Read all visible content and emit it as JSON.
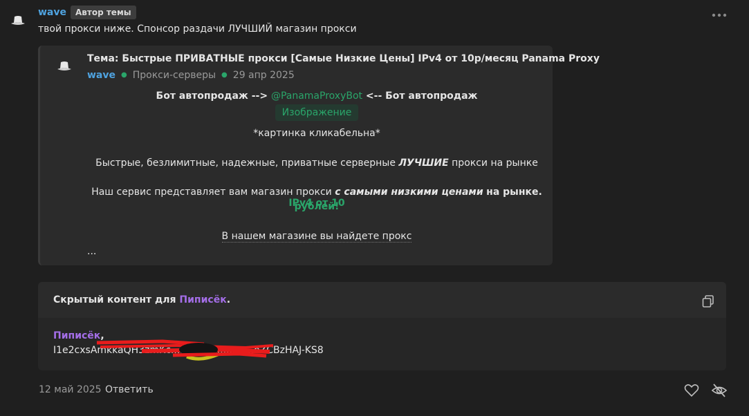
{
  "post": {
    "username": "wave",
    "badge": "Автор темы",
    "message": "твой прокси ниже. Спонсор раздачи ЛУЧШИЙ магазин прокси"
  },
  "quote": {
    "title": "Тема: Быстрые ПРИВАТНЫЕ прокси [Самые Низкие Цены] IPv4 от 10р/месяц Panama Proxy",
    "author": "wave",
    "forum": "Прокси-серверы",
    "date": "29 апр 2025",
    "bot_prefix": "Бот автопродаж -->",
    "bot_link": "@PanamaProxyBot",
    "bot_suffix": "<-- Бот автопродаж",
    "image_label": "Изображение",
    "clickable_note": "*картинка кликабельна*",
    "line1_a": "Быстрые, безлимитные, надежные, приватные серверные",
    "line1_b": "ЛУЧШИЕ",
    "line1_c": "прокси на рынке",
    "line2_a": "Наш сервис представляет вам магазин прокси",
    "line2_b": "с самыми низкими ценами",
    "line2_c": "на рынке.",
    "line2_d": "IPv4 от 10",
    "line2_e": "рублей!",
    "line3": "В нашем магазине вы найдете прокс",
    "ellipsis": "..."
  },
  "hidden": {
    "title_prefix": "Скрытый контент для",
    "group": "Пиписёк",
    "title_suffix": ".",
    "name": "Пиписёк",
    "name_suffix": ",",
    "code": "I1e2cxsAmkkaQH3zmKc...........................oZCBzHAJ-KS8"
  },
  "footer": {
    "date": "12 май 2025",
    "reply": "Ответить"
  },
  "icons": {
    "avatar": "bucket-hat-icon",
    "more": "more-dots-icon",
    "copy": "copy-icon",
    "like": "heart-icon",
    "hide": "eye-off-icon"
  },
  "colors": {
    "background": "#1f1f1f",
    "username": "#4fa3e0",
    "link_green": "#2aa56a",
    "group_purple": "#a46ee8"
  }
}
